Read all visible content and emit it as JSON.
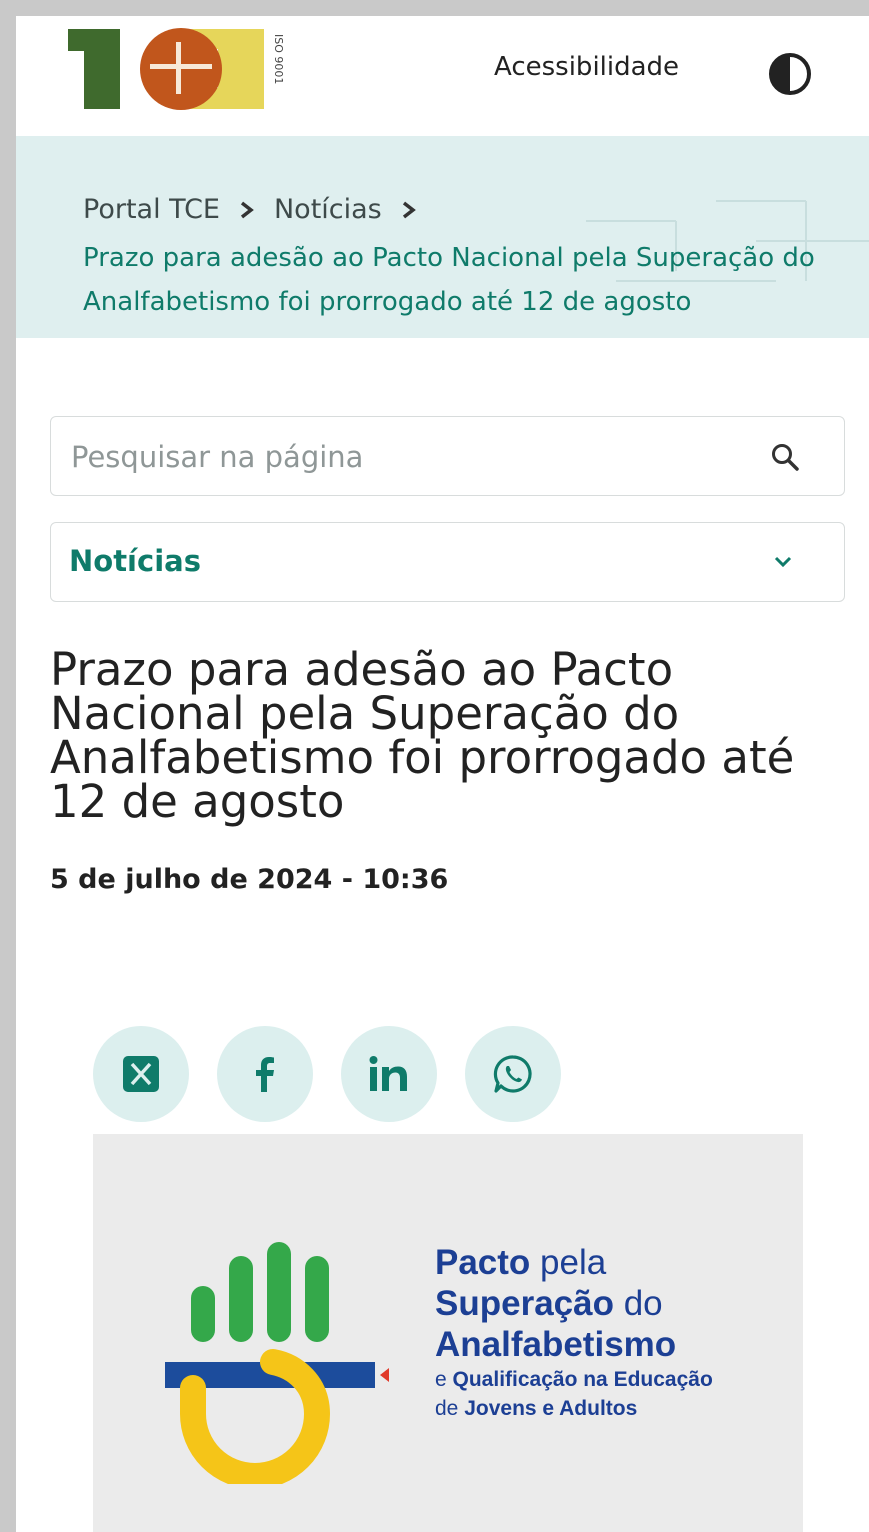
{
  "header": {
    "logo_text": "TCE",
    "logo_iso": "ISO 9001",
    "accessibility_label": "Acessibilidade",
    "contrast_icon": "contrast-icon"
  },
  "breadcrumb": {
    "items": [
      "Portal TCE",
      "Notícias"
    ],
    "current": "Prazo para adesão ao Pacto Nacional pela Superação do Analfabetismo foi prorrogado até 12 de agosto"
  },
  "search": {
    "placeholder": "Pesquisar na página",
    "icon": "search-icon"
  },
  "section_select": {
    "selected": "Notícias",
    "icon": "chevron-down-icon"
  },
  "article": {
    "title": "Prazo para adesão ao Pacto Nacional pela Superação do Analfabetismo foi prorrogado até 12 de agosto",
    "date": "5 de julho de 2024 - 10:36"
  },
  "share": {
    "buttons": [
      "x-icon",
      "facebook-icon",
      "linkedin-icon",
      "whatsapp-icon"
    ]
  },
  "banner": {
    "line1_bold": "Pacto",
    "line1_rest": " pela",
    "line2_bold": "Superação",
    "line2_rest": " do",
    "line3_bold": "Analfabetismo",
    "line4_pre": "e ",
    "line4_bold": "Qualificação na Educação",
    "line5_pre": "de ",
    "line5_bold": "Jovens e Adultos"
  },
  "colors": {
    "accent": "#0f7b6a",
    "breadcrumb_bg": "#dfefef",
    "share_bg": "#dcefee",
    "banner_blue": "#1c3f94",
    "banner_green": "#34a84a",
    "banner_yellow": "#f5c518"
  }
}
